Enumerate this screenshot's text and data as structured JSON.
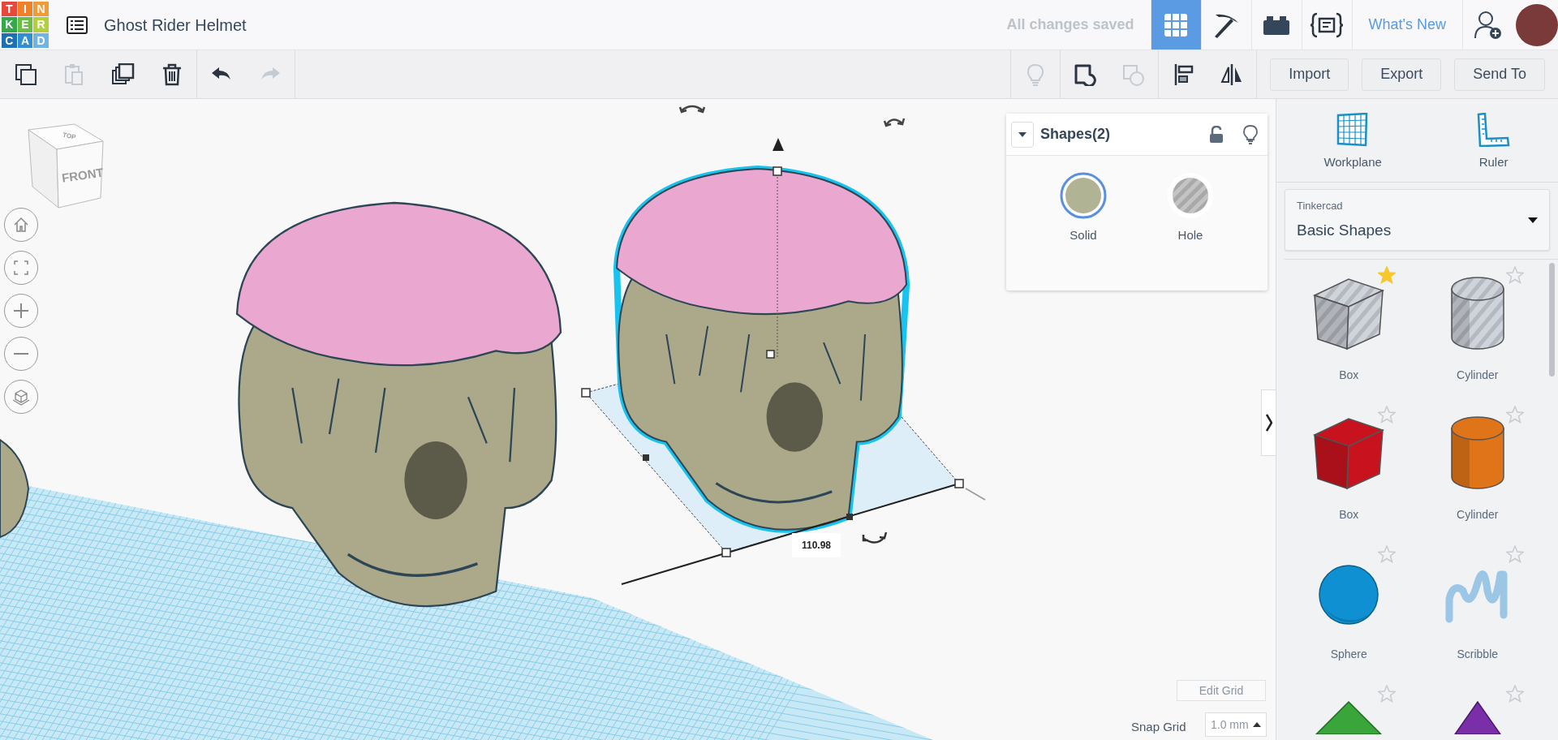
{
  "header": {
    "logo_letters": [
      {
        "text": "T",
        "color": "#e8483a"
      },
      {
        "text": "I",
        "color": "#f07f2a"
      },
      {
        "text": "N",
        "color": "#f39b33"
      },
      {
        "text": "K",
        "color": "#35a94a"
      },
      {
        "text": "E",
        "color": "#6bbd45"
      },
      {
        "text": "R",
        "color": "#b3cf3a"
      },
      {
        "text": "C",
        "color": "#1f6fb5"
      },
      {
        "text": "A",
        "color": "#2f8fd0"
      },
      {
        "text": "D",
        "color": "#6fb4e3"
      }
    ],
    "title": "Ghost Rider Helmet",
    "save_status": "All changes saved",
    "views": [
      {
        "kind": "grid",
        "selected": true
      },
      {
        "kind": "pickaxe",
        "selected": false
      },
      {
        "kind": "bricks",
        "selected": false
      },
      {
        "kind": "codeblocks",
        "selected": false
      }
    ],
    "whats_new": "What's New"
  },
  "toolbar": {
    "edit_tools": [
      {
        "kind": "copy",
        "disabled": false
      },
      {
        "kind": "paste",
        "disabled": true
      },
      {
        "kind": "duplicate",
        "disabled": false
      },
      {
        "kind": "delete",
        "disabled": false
      }
    ],
    "history": [
      {
        "kind": "undo",
        "disabled": false
      },
      {
        "kind": "redo",
        "disabled": true
      }
    ],
    "shape_tools": [
      {
        "kind": "bulb",
        "disabled": true
      },
      {
        "kind": "group",
        "disabled": false
      },
      {
        "kind": "ungroup",
        "disabled": true
      },
      {
        "kind": "align",
        "disabled": false
      },
      {
        "kind": "mirror",
        "disabled": false
      }
    ],
    "buttons": [
      "Import",
      "Export",
      "Send To"
    ]
  },
  "viewport": {
    "view_cube": {
      "top": "TOP",
      "front": "FRONT"
    },
    "nav_buttons": [
      {
        "kind": "home"
      },
      {
        "kind": "fit"
      },
      {
        "kind": "zoom-in"
      },
      {
        "kind": "zoom-out"
      },
      {
        "kind": "perspective"
      }
    ],
    "dimension": "110.98",
    "edit_grid": "Edit Grid",
    "snap_grid": {
      "label": "Snap Grid",
      "value": "1.0 mm"
    }
  },
  "inspector": {
    "title": "Shapes(2)",
    "locked": false,
    "options": [
      {
        "kind": "solid",
        "label": "Solid",
        "selected": true
      },
      {
        "kind": "hole",
        "label": "Hole",
        "selected": false
      }
    ]
  },
  "sidebar": {
    "tools": [
      {
        "kind": "workplane",
        "label": "Workplane"
      },
      {
        "kind": "ruler",
        "label": "Ruler"
      }
    ],
    "library": {
      "provider": "Tinkercad",
      "category": "Basic Shapes"
    },
    "shapes": [
      {
        "kind": "box",
        "label": "Box",
        "hole": true,
        "favorite": true,
        "color": "#c5c9d0"
      },
      {
        "kind": "cylinder",
        "label": "Cylinder",
        "hole": true,
        "favorite": false,
        "color": "#c5c9d0"
      },
      {
        "kind": "box",
        "label": "Box",
        "hole": false,
        "favorite": false,
        "color": "#c8131f"
      },
      {
        "kind": "cylinder",
        "label": "Cylinder",
        "hole": false,
        "favorite": false,
        "color": "#e07418"
      },
      {
        "kind": "sphere",
        "label": "Sphere",
        "hole": false,
        "favorite": false,
        "color": "#0f90d2"
      },
      {
        "kind": "scribble",
        "label": "Scribble",
        "hole": false,
        "favorite": false,
        "color": "#9cc6e6"
      },
      {
        "kind": "pyramid",
        "hole": false,
        "favorite": false,
        "color": "#3aa53a"
      },
      {
        "kind": "cone",
        "hole": false,
        "favorite": false,
        "color": "#7a2fa8"
      }
    ]
  }
}
